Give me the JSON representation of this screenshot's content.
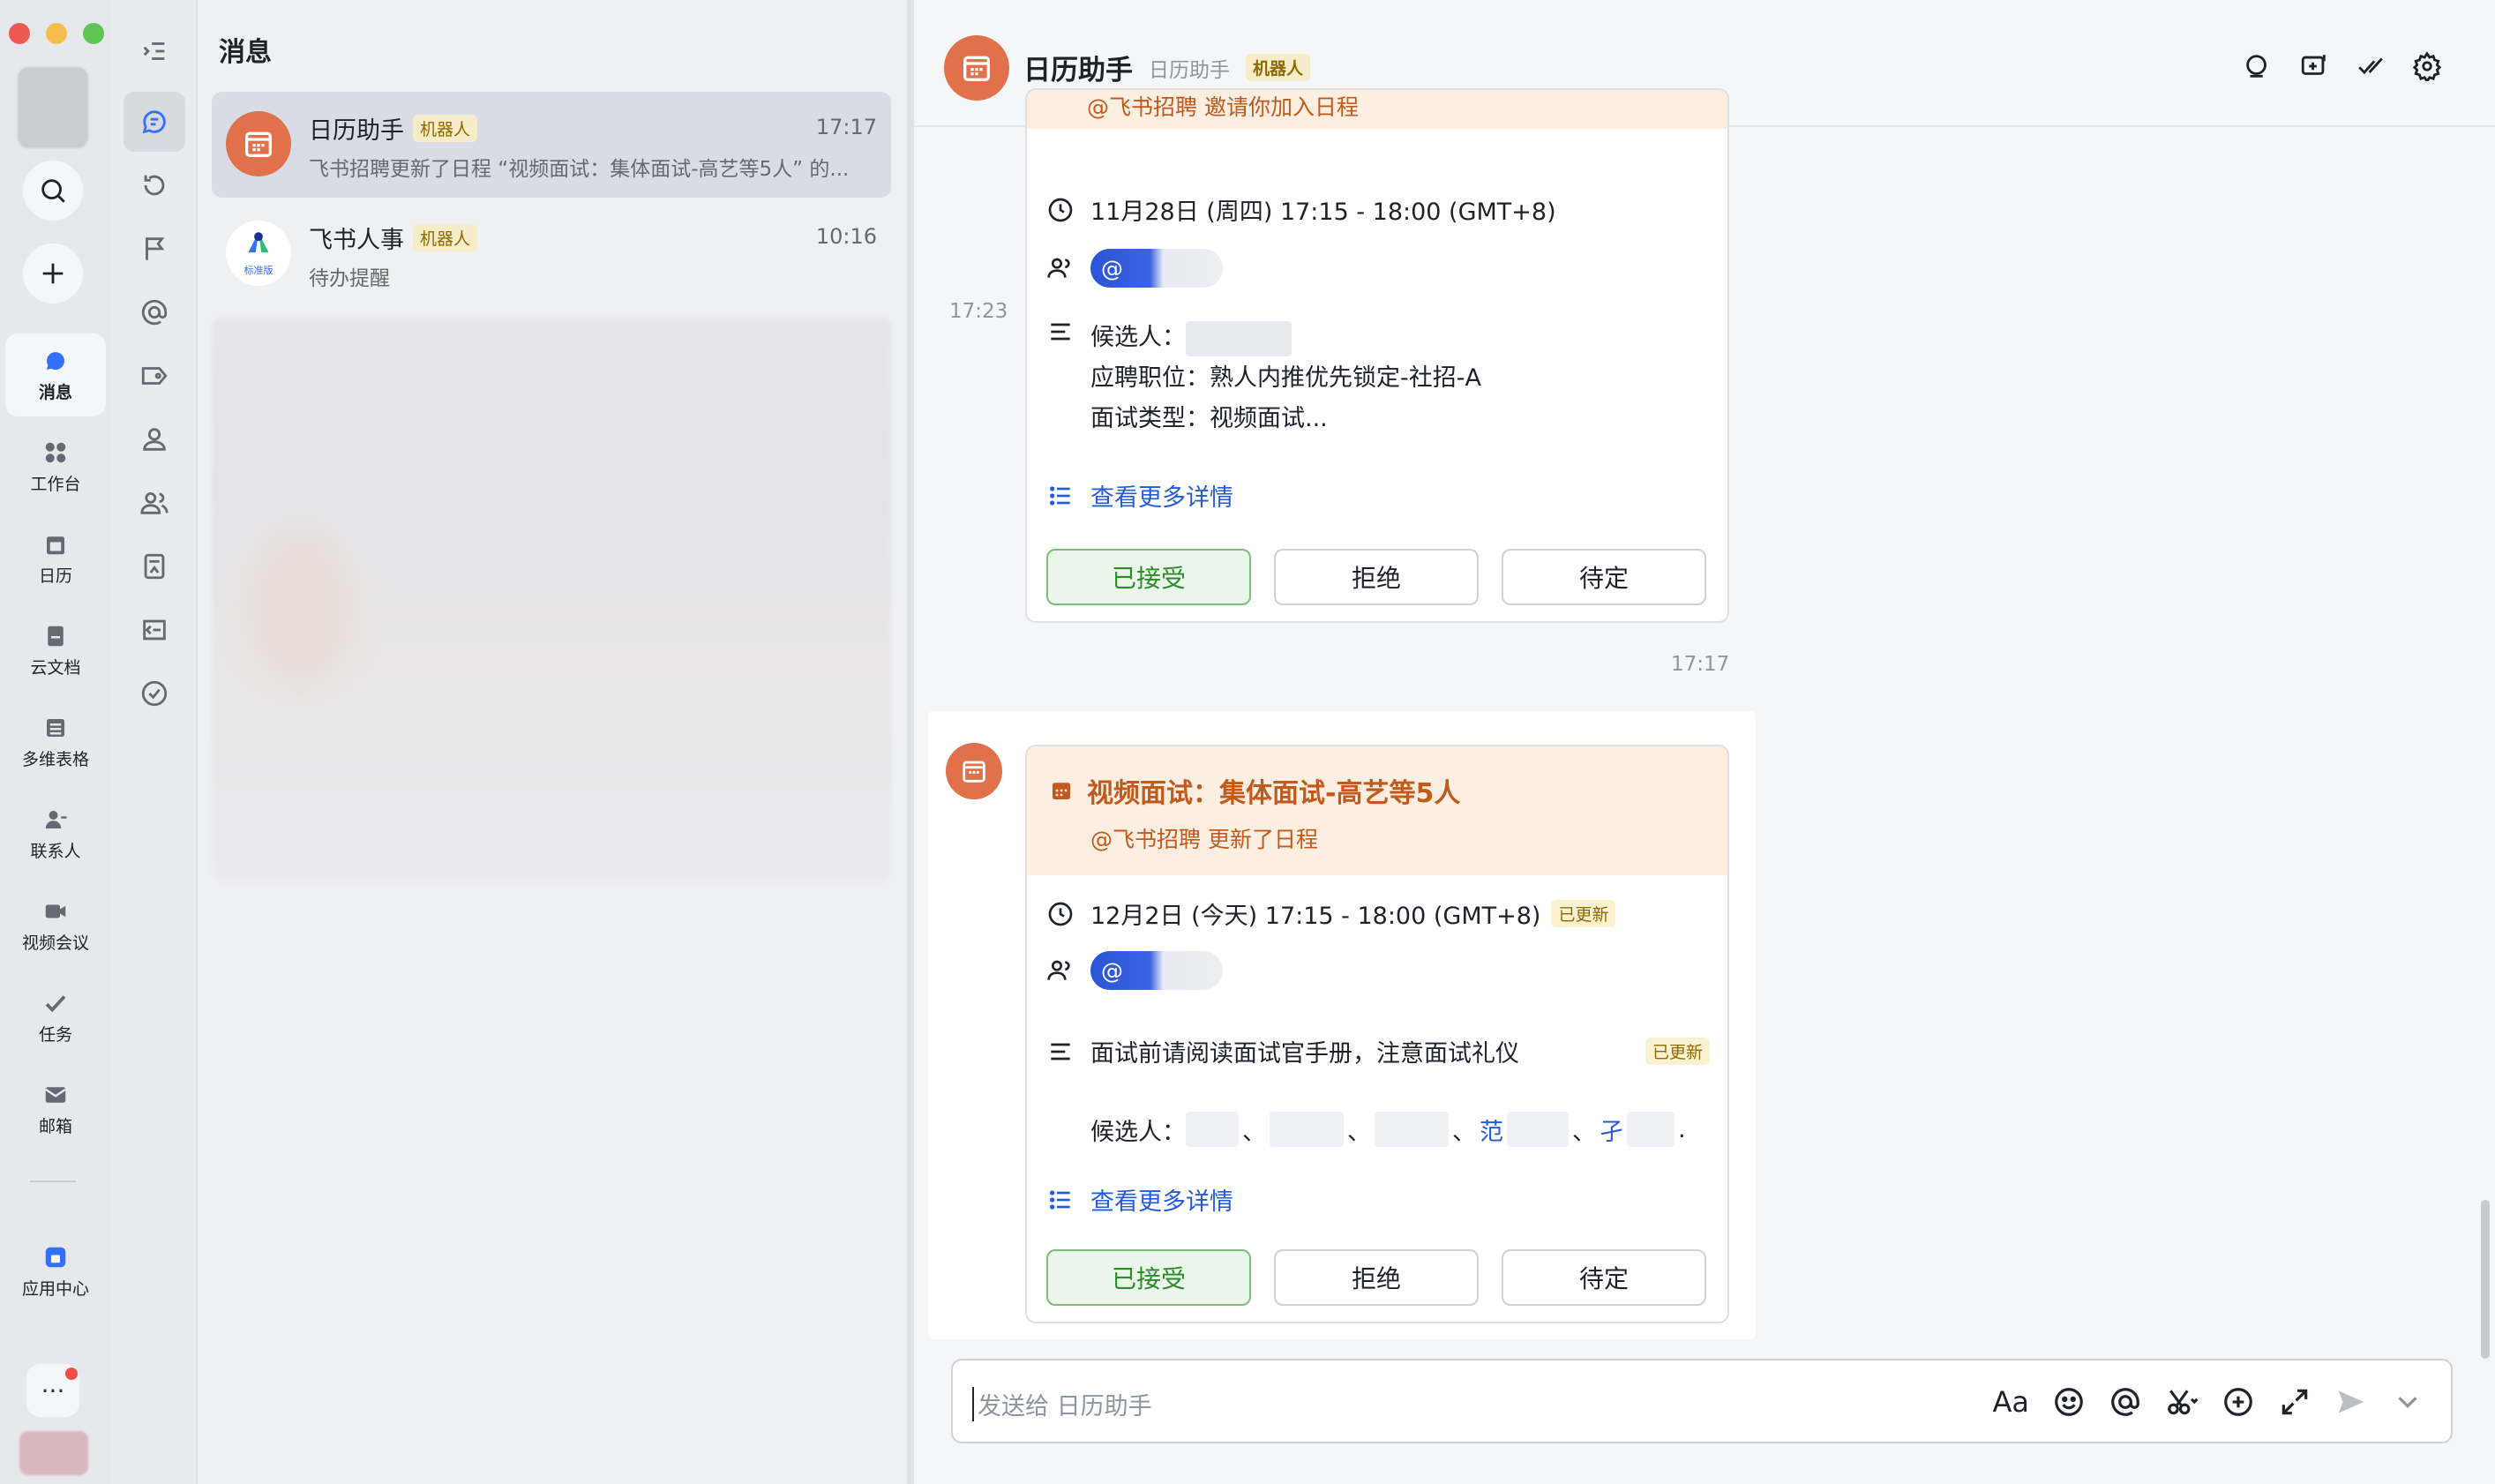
{
  "rail": {
    "items": [
      {
        "label": "消息",
        "icon": "message-icon"
      },
      {
        "label": "工作台",
        "icon": "workplace-icon"
      },
      {
        "label": "日历",
        "icon": "calendar-icon"
      },
      {
        "label": "云文档",
        "icon": "docs-icon"
      },
      {
        "label": "多维表格",
        "icon": "base-icon"
      },
      {
        "label": "联系人",
        "icon": "contacts-icon"
      },
      {
        "label": "视频会议",
        "icon": "video-icon"
      },
      {
        "label": "任务",
        "icon": "task-icon"
      },
      {
        "label": "邮箱",
        "icon": "mail-icon"
      },
      {
        "label": "应用中心",
        "icon": "app-center-icon"
      }
    ],
    "more_label": "···"
  },
  "list": {
    "title": "消息",
    "conversations": [
      {
        "name": "日历助手",
        "tag": "机器人",
        "time": "17:17",
        "preview": "飞书招聘更新了日程 “视频面试：集体面试-高艺等5人” 的..."
      },
      {
        "name": "飞书人事",
        "tag": "机器人",
        "time": "10:16",
        "preview": "待办提醒",
        "avatar_badge": "标准版"
      }
    ]
  },
  "chat": {
    "title": "日历助手",
    "subtitle": "日历助手",
    "tag": "机器人",
    "card1": {
      "sub": "@飞书招聘 邀请你加入日程",
      "time": "11月28日 (周四) 17:15 - 18:00 (GMT+8)",
      "at": "@",
      "desc1": "候选人：",
      "desc2": "应聘职位：熟人内推优先锁定-社招-A",
      "desc3": "面试类型：视频面试...",
      "more": "查看更多详情",
      "accept": "已接受",
      "decline": "拒绝",
      "tentative": "待定",
      "timestamp": "17:23"
    },
    "divider_time": "17:17",
    "card2": {
      "title": "视频面试：集体面试-高艺等5人",
      "sub": "@飞书招聘 更新了日程",
      "time": "12月2日 (今天) 17:15 - 18:00 (GMT+8)",
      "updated": "已更新",
      "at": "@",
      "desc": "面试前请阅读面试官手册，注意面试礼仪",
      "desc_updated": "已更新",
      "candidates_label": "候选人：",
      "cand_sep1": "、",
      "cand_sep2": "、",
      "cand_sep3": "、",
      "cand_sep4": "、",
      "cand_link1": "范",
      "cand_link2": "孑",
      "cand_end": ".",
      "more": "查看更多详情",
      "accept": "已接受",
      "decline": "拒绝",
      "tentative": "待定"
    },
    "composer_placeholder": "发送给 日历助手",
    "composer_font_label": "Aa"
  },
  "colors": {
    "accent_orange": "#e0714a",
    "link_blue": "#245bdb",
    "accepted_green": "#2e8b2a"
  }
}
